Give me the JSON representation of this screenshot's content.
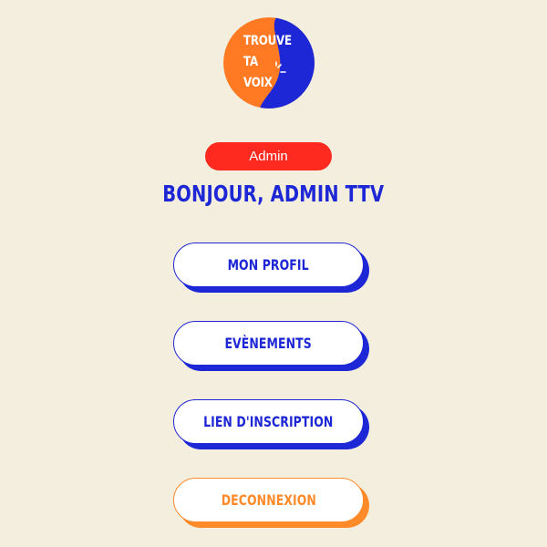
{
  "logo": {
    "lines": [
      "TROUVE",
      "TA",
      "VOIX"
    ],
    "colors": {
      "orange": "#ff7a22",
      "blue": "#1d27d6",
      "text": "#ffffff"
    }
  },
  "role_badge": {
    "label": "Admin",
    "color": "#ff2a1f"
  },
  "greeting": "BONJOUR, ADMIN TTV",
  "menu": {
    "profile_label": "MON PROFIL",
    "events_label": "EVÈNEMENTS",
    "signup_link_label": "LIEN D'INSCRIPTION",
    "logout_label": "DECONNEXION"
  },
  "colors": {
    "background": "#f4eede",
    "primary": "#1d27d6",
    "accent": "#ff8a2a"
  }
}
